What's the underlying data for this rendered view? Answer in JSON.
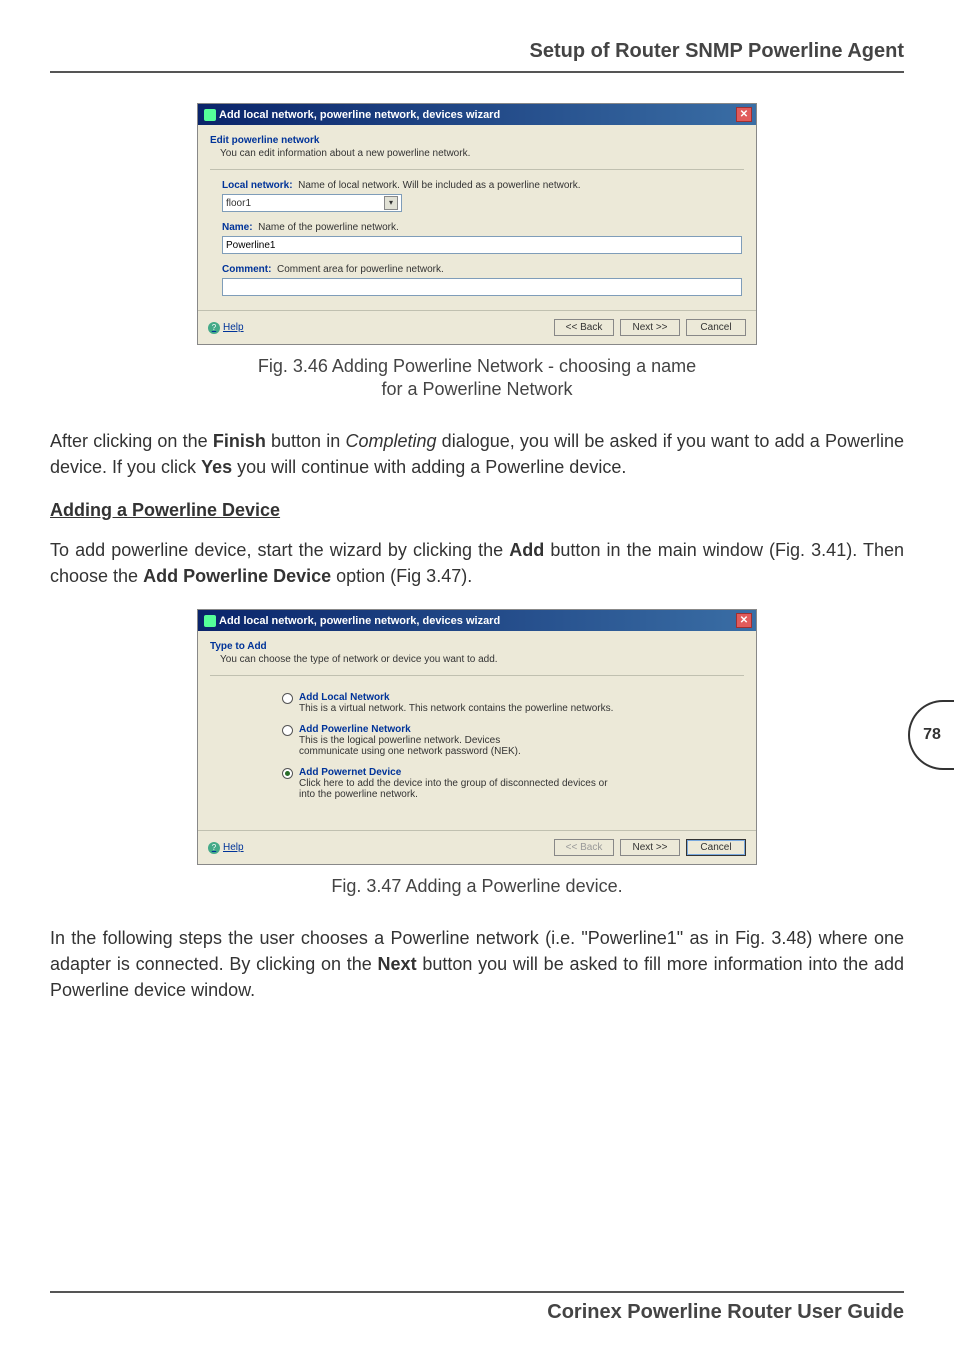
{
  "header": {
    "title": "Setup of Router SNMP Powerline Agent"
  },
  "dialog1": {
    "title": "Add local network, powerline network, devices wizard",
    "close": "✕",
    "section_title": "Edit powerline network",
    "section_sub": "You can edit information about a new powerline network.",
    "local_label": "Local network:",
    "local_desc": "Name of local network. Will be included as a powerline network.",
    "local_value": "floor1",
    "name_label": "Name:",
    "name_desc": "Name of the powerline network.",
    "name_value": "Powerline1",
    "comment_label": "Comment:",
    "comment_desc": "Comment area for powerline network.",
    "comment_value": "",
    "help": "Help",
    "back": "<< Back",
    "next": "Next >>",
    "cancel": "Cancel"
  },
  "caption1_line1": "Fig. 3.46 Adding Powerline Network - choosing a name",
  "caption1_line2": "for a Powerline Network",
  "para1_a": "After clicking on the ",
  "para1_b": "Finish",
  "para1_c": " button in ",
  "para1_d": "Completing",
  "para1_e": " dialogue, you will be asked if you want to add a Powerline device. If you click ",
  "para1_f": "Yes",
  "para1_g": " you will continue with adding a Powerline device.",
  "subheading": "Adding a Powerline Device",
  "para2_a": "To add powerline device, start the wizard by clicking the ",
  "para2_b": "Add",
  "para2_c": " button in the main window (Fig. 3.41). Then choose the ",
  "para2_d": "Add Powerline Device",
  "para2_e": " option (Fig 3.47).",
  "dialog2": {
    "title": "Add local network, powerline network, devices wizard",
    "close": "✕",
    "section_title": "Type to Add",
    "section_sub": "You can choose the type of network or  device you want to add.",
    "opt1_title": "Add Local Network",
    "opt1_desc": "This is a virtual network. This network contains the powerline networks.",
    "opt2_title": "Add Powerline Network",
    "opt2_desc1": "This is the logical powerline network. Devices",
    "opt2_desc2": "communicate using one network password (NEK).",
    "opt3_title": "Add Powernet Device",
    "opt3_desc1": "Click here to add the device into the group of disconnected devices or",
    "opt3_desc2": "into the powerline network.",
    "help": "Help",
    "back": "<< Back",
    "next": "Next >>",
    "cancel": "Cancel"
  },
  "caption2": "Fig. 3.47 Adding a Powerline device.",
  "para3_a": "In the following steps the user chooses a Powerline network (i.e. \"Powerline1\" as in Fig. 3.48) where one adapter is connected. By clicking on the ",
  "para3_b": "Next",
  "para3_c": " button you will be asked to fill more information into the add Powerline device window.",
  "page_number": "78",
  "footer": {
    "text": "Corinex Powerline Router User Guide"
  }
}
